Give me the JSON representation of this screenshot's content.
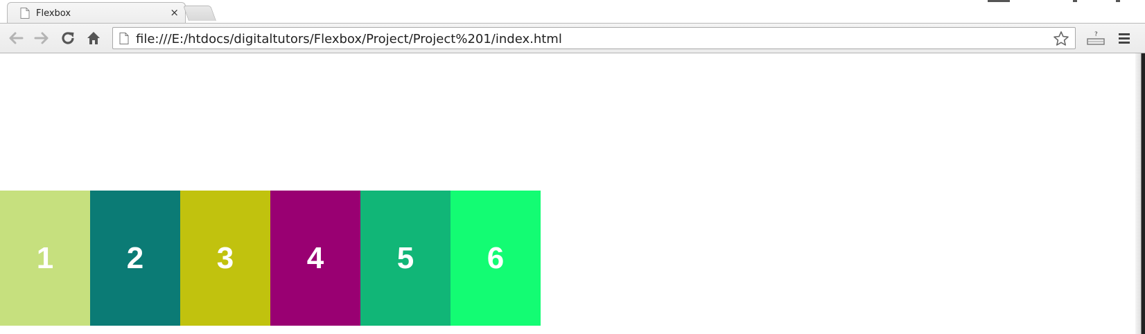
{
  "browser": {
    "tab": {
      "title": "Flexbox",
      "close_glyph": "×"
    },
    "address_bar": {
      "url": "file:///E:/htdocs/digitaltutors/Flexbox/Project/Project%201/index.html"
    },
    "icons": {
      "back": "back-arrow-icon",
      "forward": "forward-arrow-icon",
      "reload": "reload-icon",
      "home": "home-icon",
      "page": "page-icon",
      "bookmark": "star-icon",
      "extension": "extension-icon",
      "menu": "hamburger-menu-icon"
    }
  },
  "page": {
    "boxes": [
      {
        "label": "1",
        "color": "#c6e07e"
      },
      {
        "label": "2",
        "color": "#0b7b75"
      },
      {
        "label": "3",
        "color": "#c1c20e"
      },
      {
        "label": "4",
        "color": "#990072"
      },
      {
        "label": "5",
        "color": "#11b677"
      },
      {
        "label": "6",
        "color": "#13fc73"
      }
    ]
  }
}
